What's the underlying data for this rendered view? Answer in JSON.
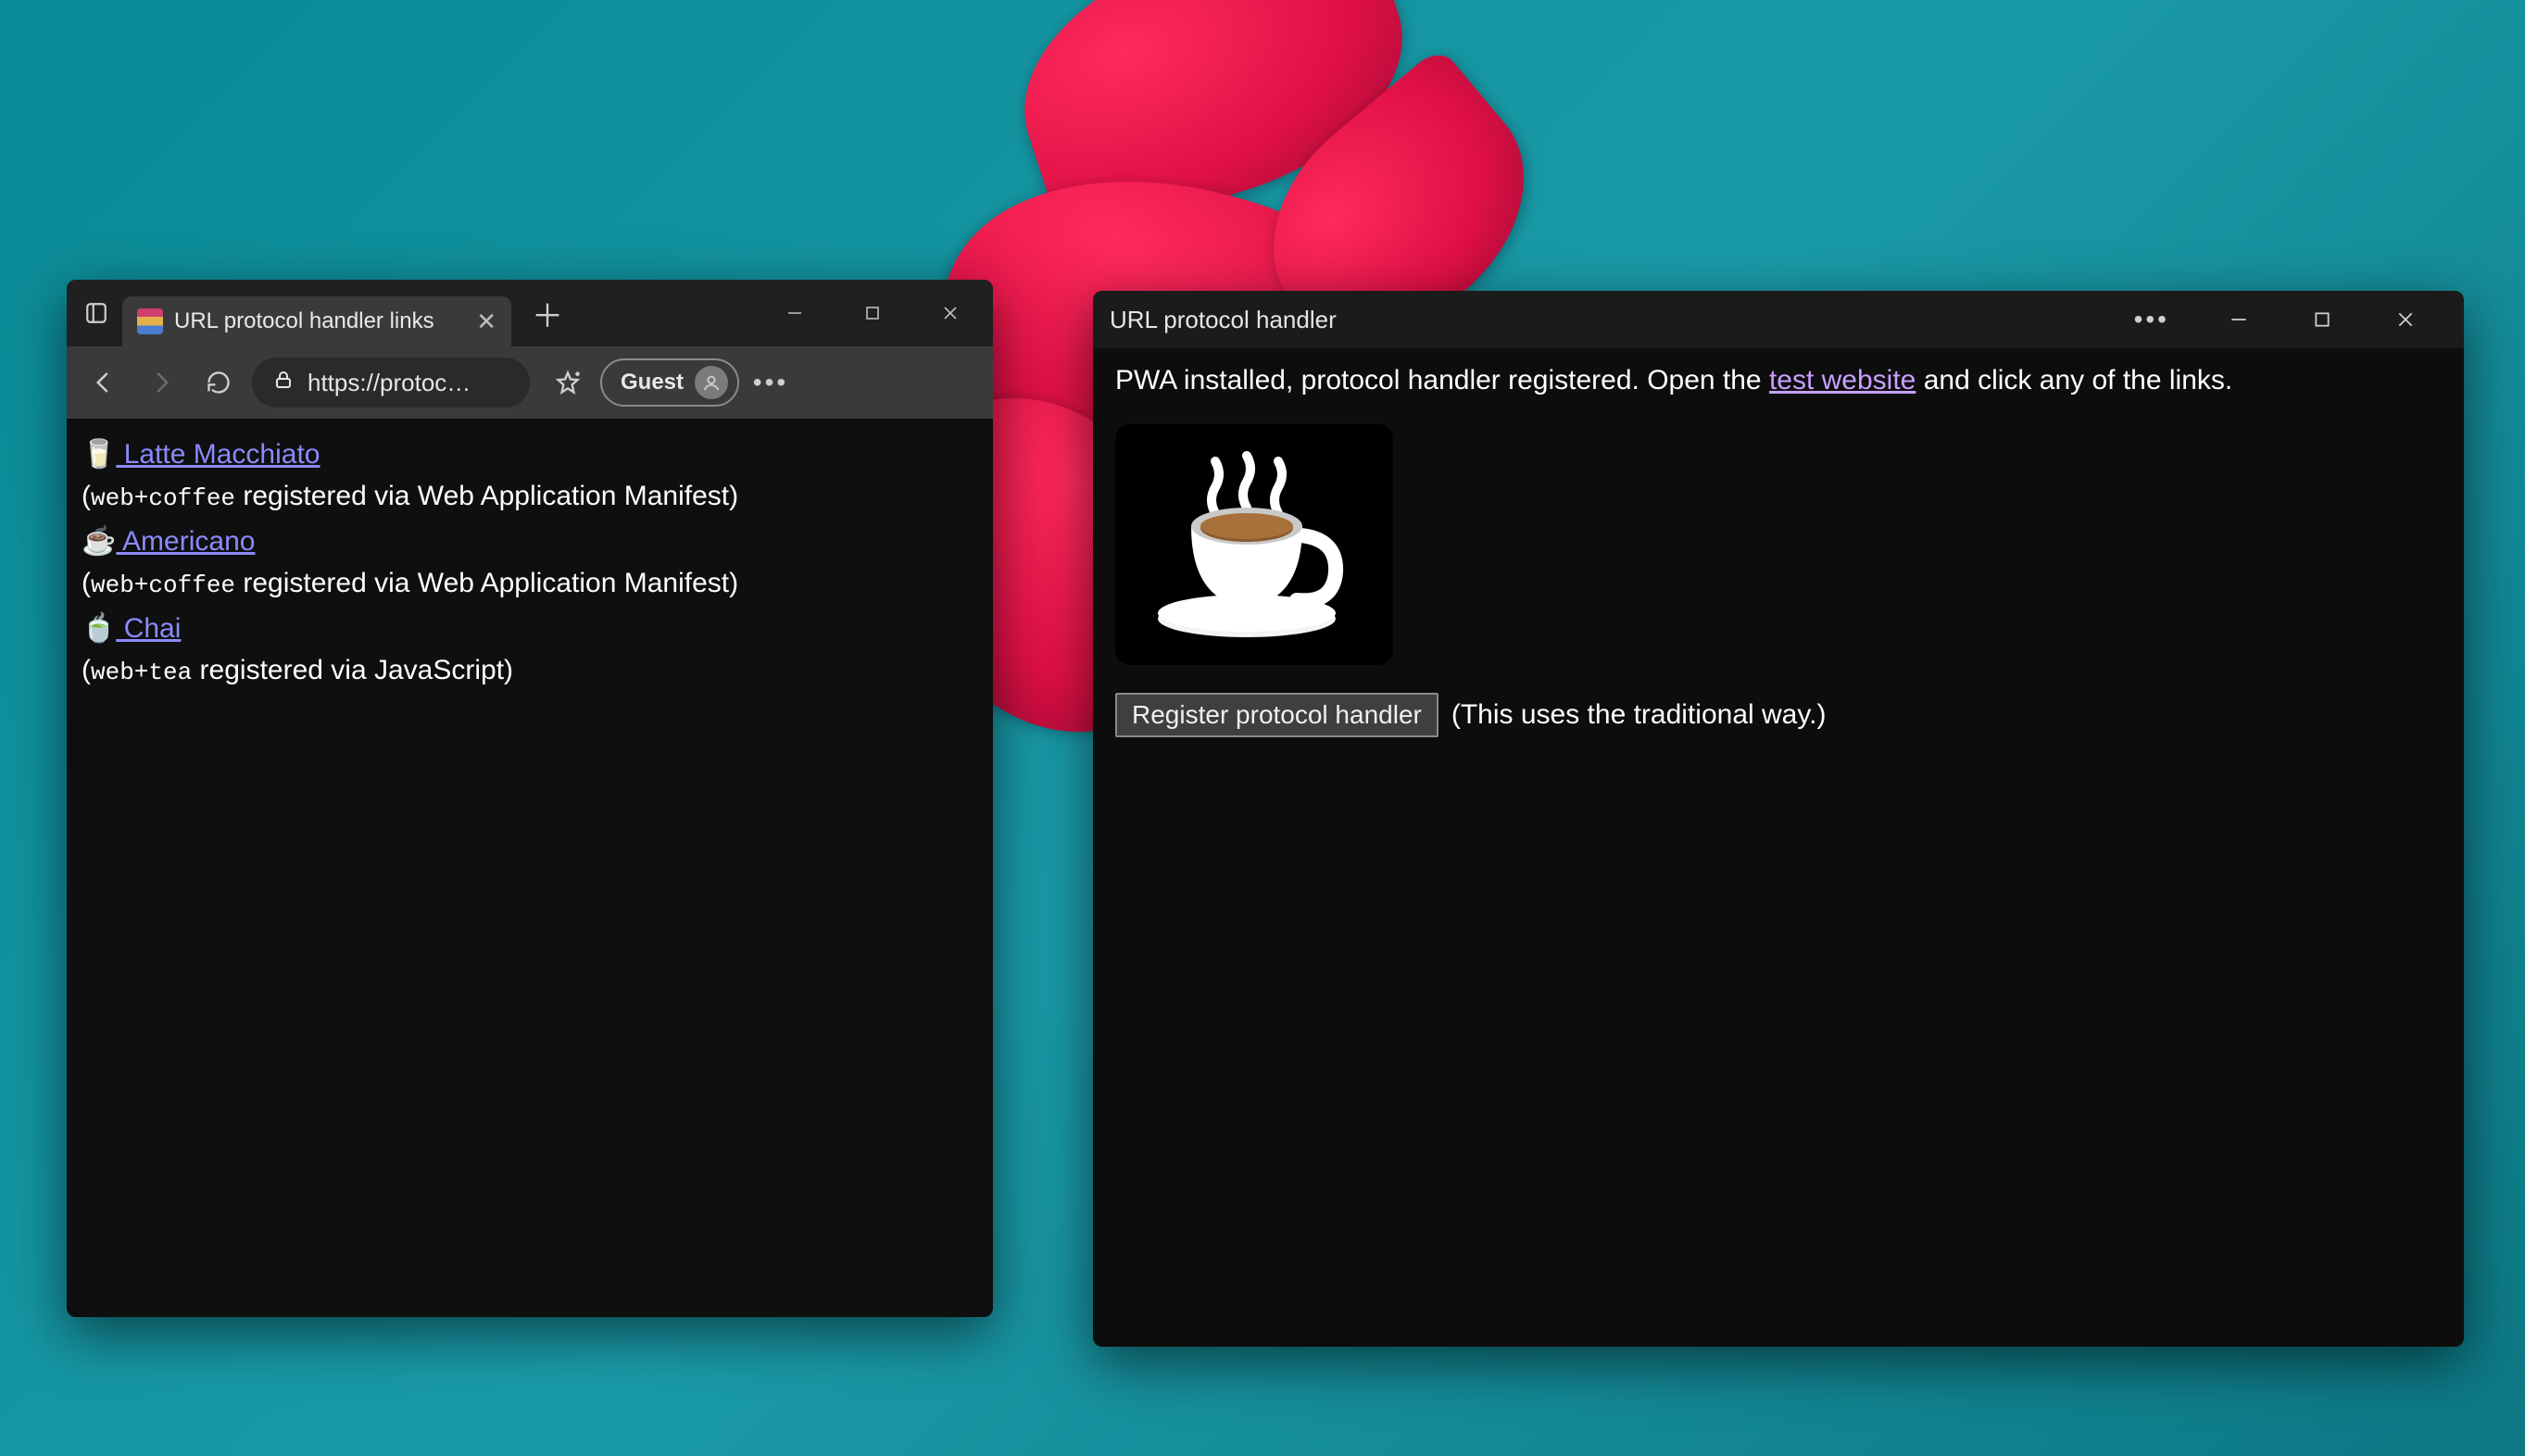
{
  "browser": {
    "tab_title": "URL protocol handler links",
    "url_display": "https://protoc…",
    "guest_label": "Guest",
    "links": [
      {
        "emoji": "🥛",
        "label": " Latte Macchiato",
        "note_prefix": "(",
        "note_code": "web+coffee",
        "note_rest": " registered via Web Application Manifest)"
      },
      {
        "emoji": "☕",
        "label": " Americano",
        "note_prefix": "(",
        "note_code": "web+coffee",
        "note_rest": " registered via Web Application Manifest)"
      },
      {
        "emoji": "🍵",
        "label": " Chai",
        "note_prefix": "(",
        "note_code": "web+tea",
        "note_rest": " registered via JavaScript)"
      }
    ]
  },
  "pwa": {
    "title": "URL protocol handler",
    "text_before_link": "PWA installed, protocol handler registered. Open the ",
    "link_text": "test website",
    "text_after_link": " and click any of the links.",
    "button_label": "Register protocol handler",
    "button_note": "(This uses the traditional way.)"
  }
}
